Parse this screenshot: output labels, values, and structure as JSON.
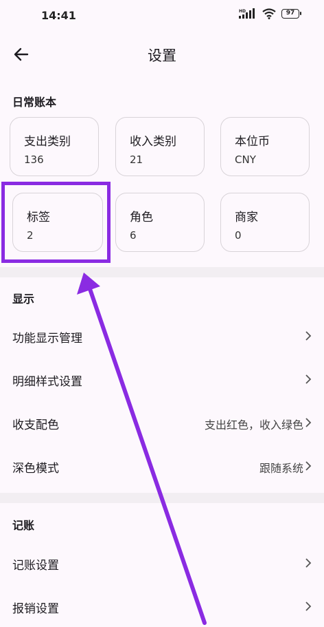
{
  "status": {
    "time": "14:41",
    "battery": "97",
    "network": "HD"
  },
  "header": {
    "title": "设置"
  },
  "sections": {
    "daily": {
      "title": "日常账本",
      "cards": [
        {
          "label": "支出类别",
          "value": "136"
        },
        {
          "label": "收入类别",
          "value": "21"
        },
        {
          "label": "本位币",
          "value": "CNY"
        },
        {
          "label": "标签",
          "value": "2"
        },
        {
          "label": "角色",
          "value": "6"
        },
        {
          "label": "商家",
          "value": "0"
        }
      ]
    },
    "display": {
      "title": "显示",
      "rows": [
        {
          "label": "功能显示管理",
          "value": ""
        },
        {
          "label": "明细样式设置",
          "value": ""
        },
        {
          "label": "收支配色",
          "value": "支出红色，收入绿色"
        },
        {
          "label": "深色模式",
          "value": "跟随系统"
        }
      ]
    },
    "bookkeeping": {
      "title": "记账",
      "rows": [
        {
          "label": "记账设置",
          "value": ""
        },
        {
          "label": "报销设置",
          "value": ""
        }
      ]
    }
  },
  "annotation": {
    "highlight_color": "#8a2be2",
    "arrow_color": "#8a2be2"
  }
}
